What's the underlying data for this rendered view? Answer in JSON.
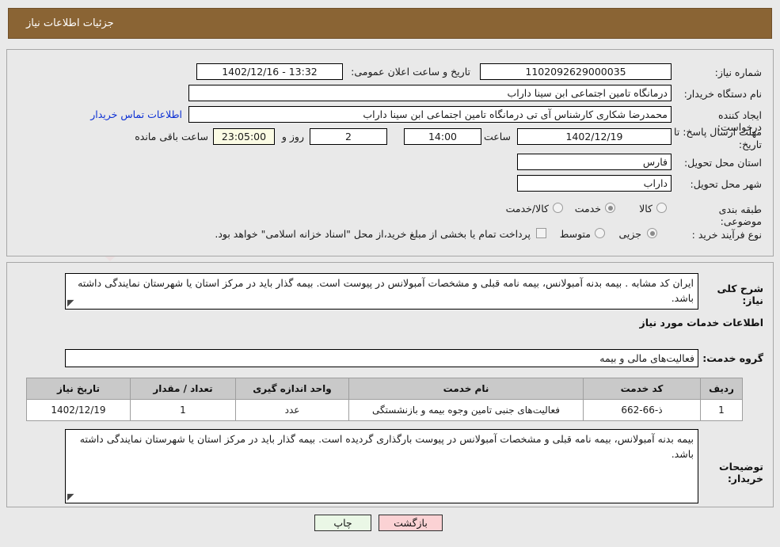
{
  "header": {
    "title": "جزئیات اطلاعات نیاز",
    "bg_color": "#8a6434"
  },
  "watermark": {
    "text": "AnaTender.net"
  },
  "form": {
    "need_number_label": "شماره نیاز:",
    "need_number_value": "1102092629000035",
    "announce_datetime_label": "تاریخ و ساعت اعلان عمومی:",
    "announce_datetime_value": "13:32 - 1402/12/16",
    "buyer_org_label": "نام دستگاه خریدار:",
    "buyer_org_value": "درمانگاه تامین اجتماعی ابن سینا داراب",
    "requester_label": "ایجاد کننده درخواست:",
    "requester_value": "محمدرضا شکاری کارشناس آی تی درمانگاه تامین اجتماعی ابن سینا داراب",
    "contact_link": "اطلاعات تماس خریدار",
    "deadline_label": "مهلت ارسال پاسخ: تا تاریخ:",
    "deadline_date": "1402/12/19",
    "hour_label": "ساعت",
    "deadline_time": "14:00",
    "days_value": "2",
    "days_label": "روز و",
    "remaining_time": "23:05:00",
    "remaining_label": "ساعت باقی مانده",
    "province_label": "استان محل تحویل:",
    "province_value": "فارس",
    "city_label": "شهر محل تحویل:",
    "city_value": "داراب",
    "category_label": "طبقه بندی موضوعی:",
    "category_options": [
      {
        "label": "کالا",
        "selected": false
      },
      {
        "label": "خدمت",
        "selected": true
      },
      {
        "label": "کالا/خدمت",
        "selected": false
      }
    ],
    "process_label": "نوع فرآیند خرید :",
    "process_options": [
      {
        "label": "جزیی",
        "selected": true
      },
      {
        "label": "متوسط",
        "selected": false
      }
    ],
    "treasury_checkbox_label": "پرداخت تمام یا بخشی از مبلغ خرید،از محل \"اسناد خزانه اسلامی\" خواهد بود.",
    "treasury_checked": false
  },
  "description": {
    "label": "شرح کلی نیاز:",
    "value": "ایران کد مشابه . بیمه بدنه آمبولانس، بیمه نامه قبلی و مشخصات آمبولانس در پیوست  است. بیمه گذار باید در مرکز استان یا شهرستان نمایندگی داشته باشد."
  },
  "services_section": {
    "heading": "اطلاعات خدمات مورد نیاز",
    "group_label": "گروه خدمت:",
    "group_value": "فعالیت‌های مالی و بیمه"
  },
  "table": {
    "headers": [
      "ردیف",
      "کد خدمت",
      "نام خدمت",
      "واحد اندازه گیری",
      "تعداد / مقدار",
      "تاریخ نیاز"
    ],
    "rows": [
      {
        "row": "1",
        "code": "ذ-66-662",
        "name": "فعالیت‌های جنبی تامین وجوه بیمه و بازنشستگی",
        "unit": "عدد",
        "quantity": "1",
        "date": "1402/12/19"
      }
    ]
  },
  "buyer_notes": {
    "label": "توضیحات خریدار:",
    "value": "بیمه بدنه آمبولانس، بیمه نامه قبلی و مشخصات آمبولانس در پیوست بارگذاری گردیده است. بیمه گذار باید در مرکز استان یا شهرستان نمایندگی داشته باشد."
  },
  "footer": {
    "print_label": "چاپ",
    "back_label": "بازگشت"
  }
}
